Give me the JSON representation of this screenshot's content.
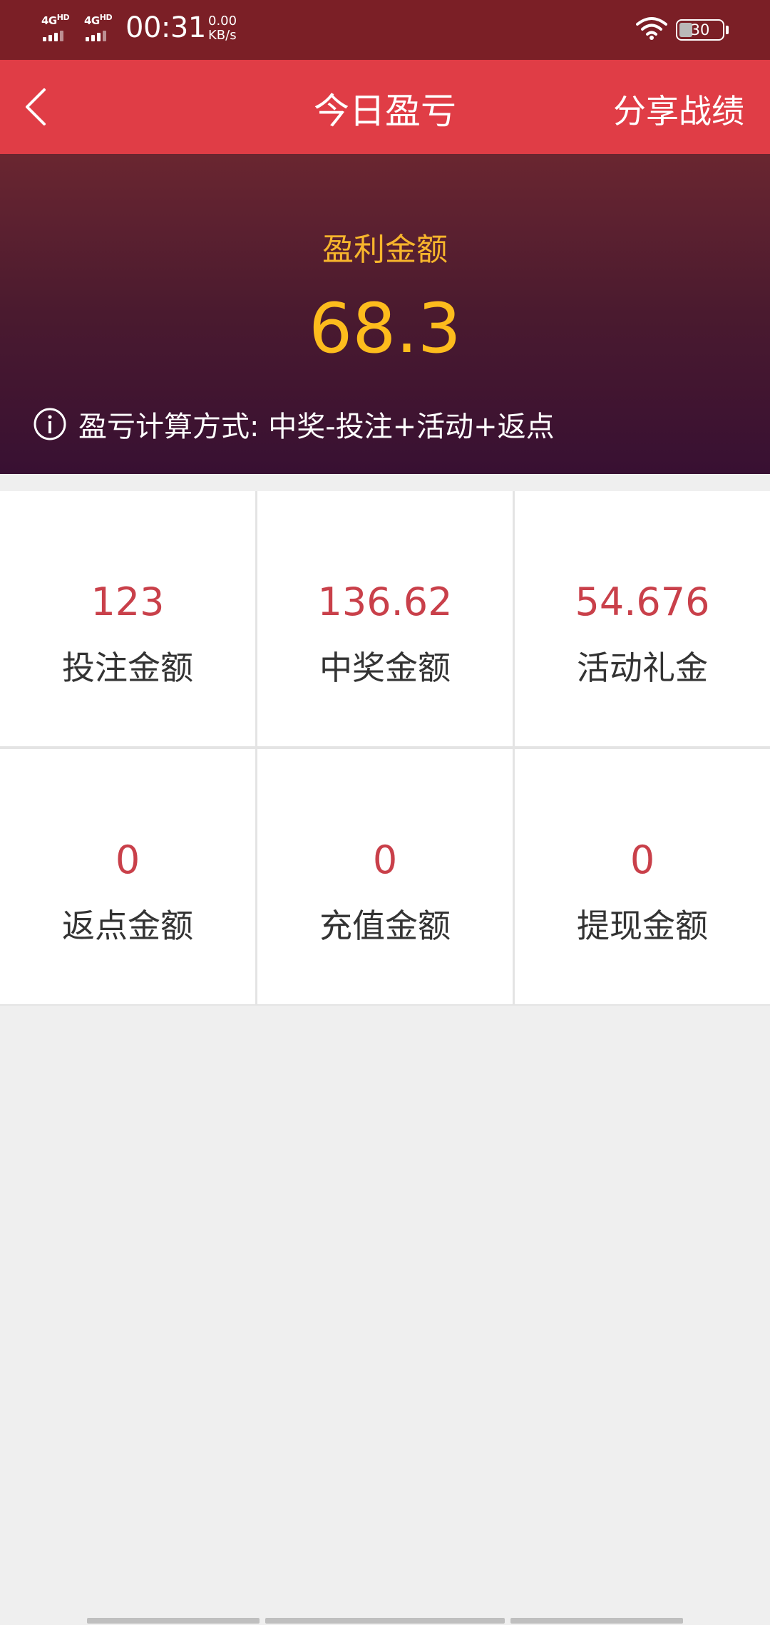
{
  "status_bar": {
    "network_1": "4G",
    "network_1_sup": "HD",
    "network_2": "4G",
    "network_2_sup": "HD",
    "time": "00:31",
    "speed_value": "0.00",
    "speed_unit": "KB/s",
    "battery": "30"
  },
  "nav": {
    "title": "今日盈亏",
    "share_label": "分享战绩",
    "back_icon": "chevron-left-icon"
  },
  "hero": {
    "label": "盈利金额",
    "value": "68.3",
    "formula": "盈亏计算方式: 中奖-投注+活动+返点",
    "info_icon": "info-circle-icon",
    "colors": {
      "label": "#f7b52c",
      "value": "#fdbc1d"
    }
  },
  "stats": [
    {
      "value": "123",
      "label": "投注金额"
    },
    {
      "value": "136.62",
      "label": "中奖金额"
    },
    {
      "value": "54.676",
      "label": "活动礼金"
    },
    {
      "value": "0",
      "label": "返点金额"
    },
    {
      "value": "0",
      "label": "充值金额"
    },
    {
      "value": "0",
      "label": "提现金额"
    }
  ],
  "colors": {
    "status_bar": "#7b1f26",
    "nav_bar": "#e03d46",
    "stat_value": "#c9404a",
    "background": "#efefef"
  }
}
